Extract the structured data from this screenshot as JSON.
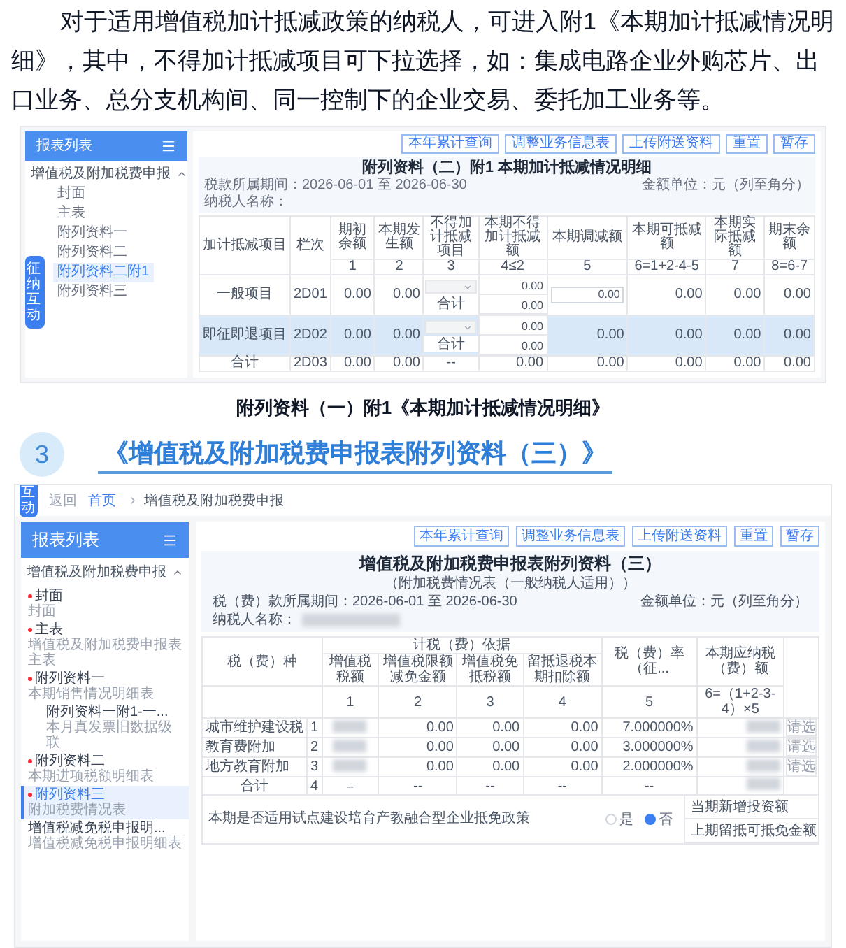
{
  "intro": "对于适用增值税加计抵减政策的纳税人，可进入附1《本期加计抵减情况明细》，其中，不得加计抵减项目可下拉选择，如：集成电路企业外购芯片、出口业务、总分支机构间、同一控制下的企业交易、委托加工业务等。",
  "figure1": {
    "sidebar_title": "报表列表",
    "float_tab": "征纳互动",
    "group": {
      "label": "增值税及附加税费申报",
      "expanded": true
    },
    "items": [
      {
        "label": "封面",
        "selected": false
      },
      {
        "label": "主表",
        "selected": false
      },
      {
        "label": "附列资料一",
        "selected": false
      },
      {
        "label": "附列资料二",
        "selected": false
      },
      {
        "label": "附列资料二附1",
        "selected": true
      },
      {
        "label": "附列资料三",
        "selected": false
      }
    ],
    "buttons": [
      "本年累计查询",
      "调整业务信息表",
      "上传附送资料",
      "重置",
      "暂存"
    ],
    "title": "附列资料（二）附1 本期加计抵减情况明细",
    "period": "税款所属期间：2026-06-01 至 2026-06-30",
    "unit": "金额单位：元（列至角分）",
    "taxpayer_label": "纳税人名称：",
    "columns": [
      "加计抵减项目",
      "栏次",
      "期初余额",
      "本期发生额",
      "不得加计抵减项目",
      "本期不得加计抵减额",
      "本期调减额",
      "本期可抵减额",
      "本期实际抵减额",
      "期末余额"
    ],
    "column_numbers": [
      "1",
      "2",
      "3",
      "4≤2",
      "5",
      "6=1+2-4-5",
      "7",
      "8=6-7"
    ],
    "rows": [
      {
        "kind": "item",
        "item": "一般项目",
        "line": "2D01",
        "values": [
          "0.00",
          "0.00"
        ],
        "sub": [
          "0.00",
          "0.00"
        ],
        "subtotal": "合计",
        "input": "0.00",
        "rest": [
          "0.00",
          "0.00",
          "0.00"
        ],
        "selected": false
      },
      {
        "kind": "item",
        "item": "即征即退项目",
        "line": "2D02",
        "values": [
          "0.00",
          "0.00"
        ],
        "sub": [
          "0.00",
          "0.00"
        ],
        "subtotal": "合计",
        "rest": [
          "0.00",
          "0.00",
          "0.00",
          "0.00"
        ],
        "selected": true
      },
      {
        "kind": "total",
        "item": "合计",
        "line": "2D03",
        "values": [
          "0.00",
          "0.00"
        ],
        "dash": "--",
        "sub": [
          "0.00"
        ],
        "rest": [
          "0.00",
          "0.00",
          "0.00",
          "0.00"
        ],
        "selected": false
      }
    ]
  },
  "caption": "附列资料（一）附1《本期加计抵减情况明细》",
  "section": {
    "number": "3",
    "title": "《增值税及附加税费申报表附列资料（三）》"
  },
  "figure2": {
    "float_tab": "互动",
    "back": "返回",
    "breadcrumb": [
      "首页",
      "增值税及附加税费申报"
    ],
    "sidebar_title": "报表列表",
    "group": {
      "label": "增值税及附加税费申报",
      "expanded": true
    },
    "items": [
      {
        "label": "封面",
        "sub": "封面",
        "required": true,
        "selected": false,
        "child": false
      },
      {
        "label": "主表",
        "sub": "增值税及附加税费申报表主表",
        "required": true,
        "selected": false,
        "child": false
      },
      {
        "label": "附列资料一",
        "sub": "本期销售情况明细表",
        "required": true,
        "selected": false,
        "child": false
      },
      {
        "label": "附列资料一附1-一...",
        "sub": "本月真发票旧数据级联",
        "required": false,
        "selected": false,
        "child": true
      },
      {
        "label": "附列资料二",
        "sub": "本期进项税额明细表",
        "required": true,
        "selected": false,
        "child": false
      },
      {
        "label": "附列资料三",
        "sub": "附加税费情况表",
        "required": true,
        "selected": true,
        "child": false
      },
      {
        "label": "增值税减免税申报明...",
        "sub": "增值税减免税申报明细表",
        "required": false,
        "selected": false,
        "child": false
      }
    ],
    "buttons": [
      "本年累计查询",
      "调整业务信息表",
      "上传附送资料",
      "重置",
      "暂存"
    ],
    "title": "增值税及附加税费申报表附列资料（三）",
    "subtitle": "（附加税费情况表（一般纳税人适用））",
    "period": "税（费）款所属期间：2026-06-01 至 2026-06-30",
    "unit": "金额单位：元（列至角分）",
    "taxpayer_label": "纳税人名称：",
    "head_tax": "税（费）种",
    "head_group": "计税（费）依据",
    "group_columns": [
      "增值税税额",
      "增值税限额减免金额",
      "增值税免抵税额",
      "留抵退税本期扣除额"
    ],
    "head_rate": "税（费）率（征...",
    "head_due": "本期应纳税（费）额",
    "column_numbers": [
      "1",
      "2",
      "3",
      "4",
      "5",
      "6=（1+2-3-4）×5"
    ],
    "rows": [
      {
        "name": "城市维护建设税",
        "line": "1",
        "values": [
          "0.00",
          "0.00",
          "0.00"
        ],
        "rate": "7.000000%",
        "hint": "请选"
      },
      {
        "name": "教育费附加",
        "line": "2",
        "values": [
          "0.00",
          "0.00",
          "0.00"
        ],
        "rate": "3.000000%",
        "hint": "请选"
      },
      {
        "name": "地方教育附加",
        "line": "3",
        "values": [
          "0.00",
          "0.00",
          "0.00"
        ],
        "rate": "2.000000%",
        "hint": "请选"
      },
      {
        "name": "合计",
        "line": "4",
        "dash": "--"
      }
    ],
    "policy": "本期是否适用试点建设培育产教融合型企业抵免政策",
    "options": [
      {
        "label": "是",
        "selected": false
      },
      {
        "label": "否",
        "selected": true
      }
    ],
    "extra_rows": [
      "当期新增投资额",
      "上期留抵可抵免金额"
    ]
  }
}
